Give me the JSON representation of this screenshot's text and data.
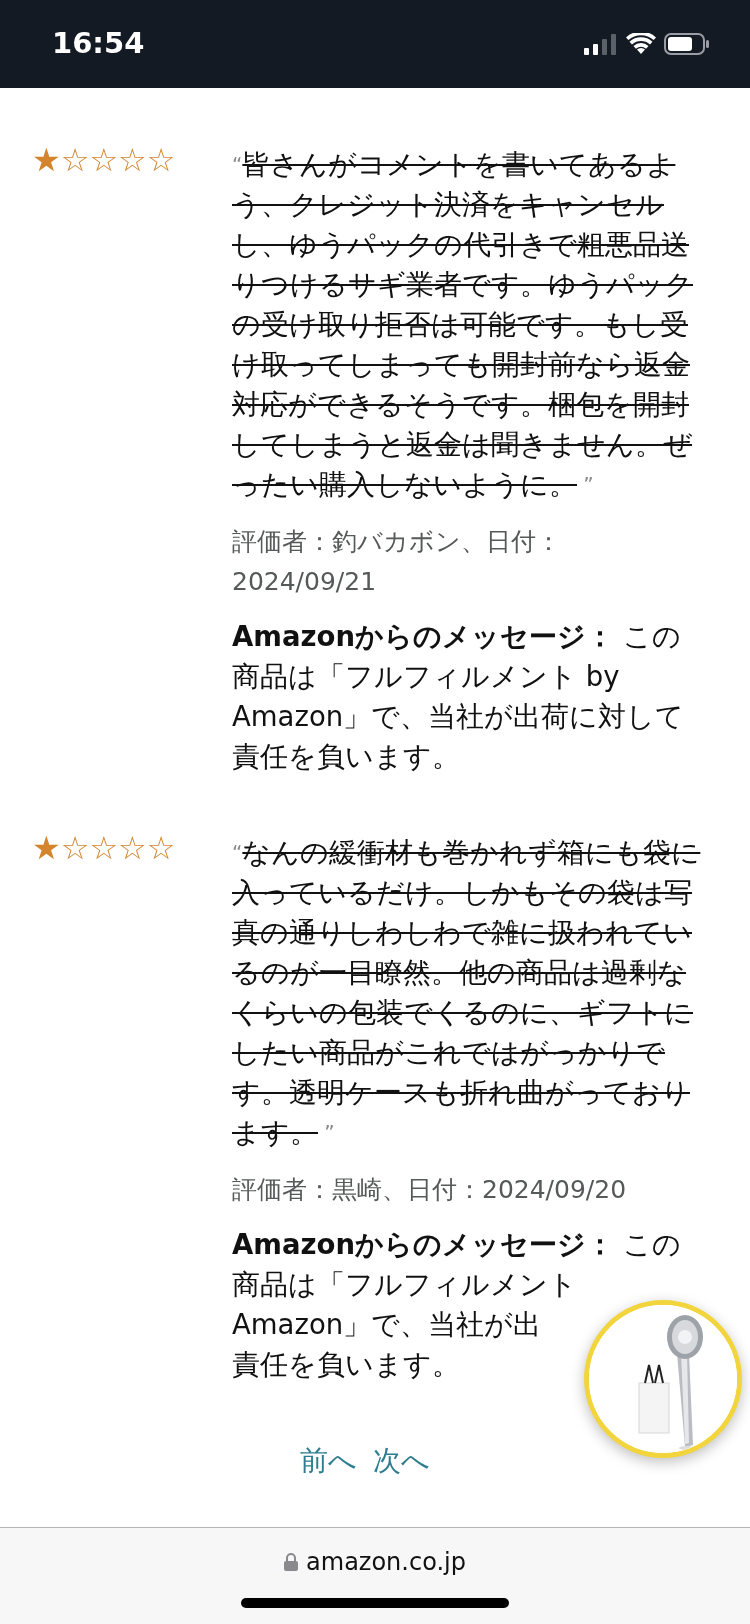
{
  "status_bar": {
    "time": "16:54"
  },
  "reviews": [
    {
      "stars": 1,
      "text": "皆さんがコメントを書いてあるよう、クレジット決済をキャンセルし、ゆうパックの代引きで粗悪品送りつけるサギ業者です。ゆうパックの受け取り拒否は可能です。もし受け取ってしまっても開封前なら返金対応ができるそうです。梱包を開封してしまうと返金は聞きません。ぜったい購入しないように。",
      "struck": true,
      "open_quote": "“",
      "close_quote": "”",
      "byline": "評価者：釣バカボン、日付：2024/09/21",
      "message": "**Amazonからのメッセージ：** この商品は「フルフィルメント by Amazon」で、当社が出荷に対して責任を負います。"
    },
    {
      "stars": 1,
      "text": "なんの緩衝材も巻かれず箱にも袋に入っているだけ。しかもその袋は写真の通りしわしわで雑に扱われているのが一目瞭然。他の商品は過剰なくらいの包装でくるのに、ギフトにしたい商品がこれではがっかりです。透明ケースも折れ曲がっております。",
      "struck": true,
      "open_quote": "“",
      "close_quote": "”",
      "byline": "評価者：黒崎、日付：2024/09/20",
      "message_lines": [
        "**Amazonからのメッセージ：** この",
        "商品は「フルフィルメント",
        "Amazon」で、当社が出",
        "責任を負います。"
      ]
    }
  ],
  "pagination": {
    "previous": "前へ",
    "next": "次へ"
  },
  "address_bar": {
    "url": "amazon.co.jp",
    "secure": true
  }
}
